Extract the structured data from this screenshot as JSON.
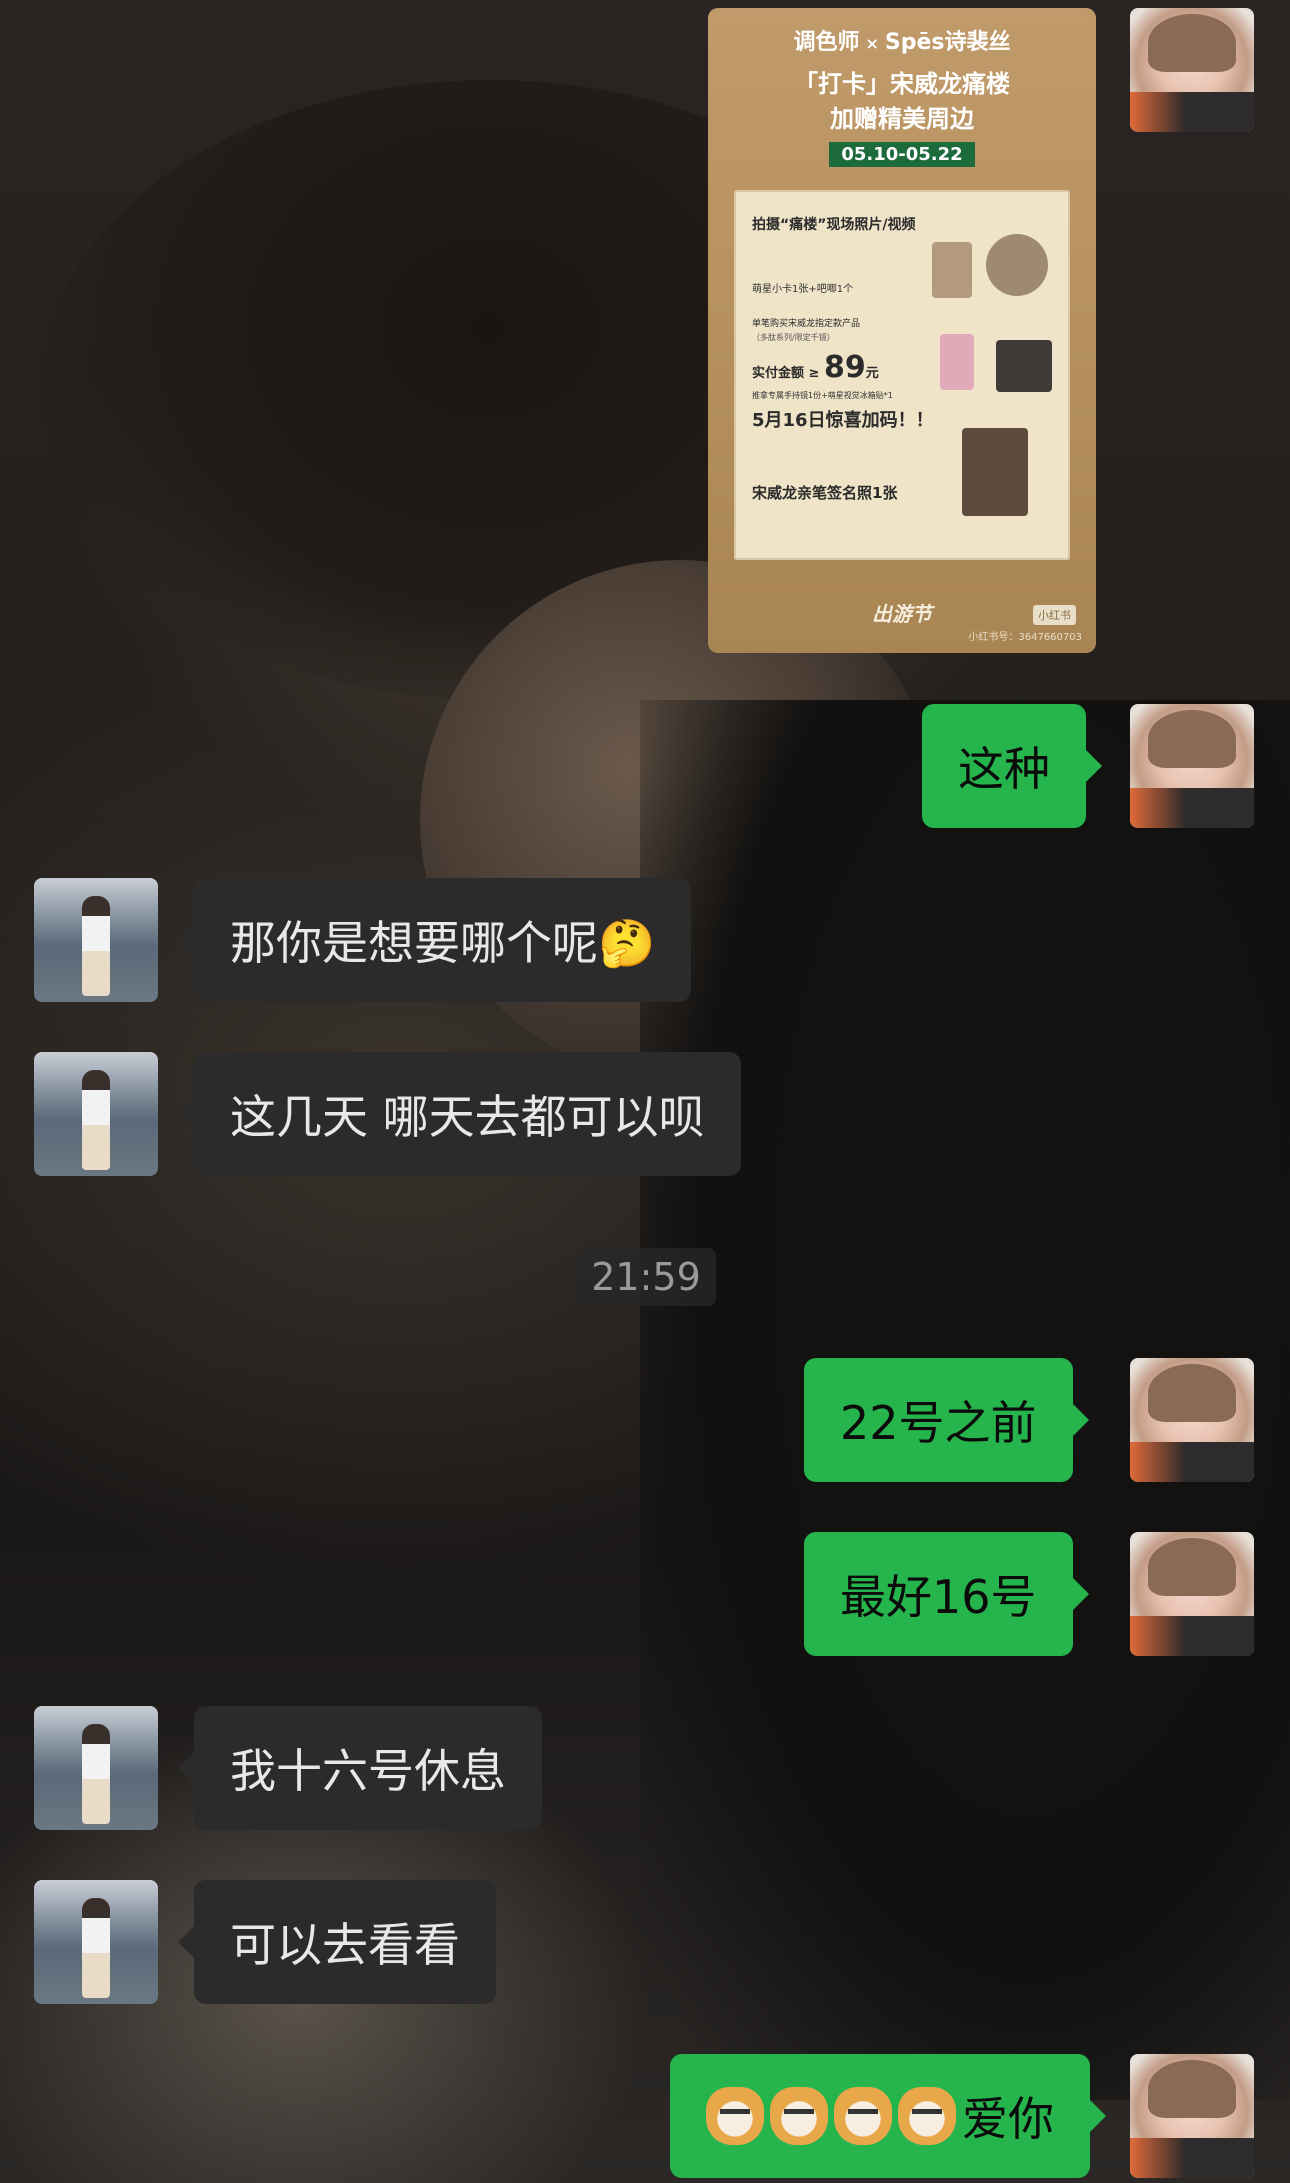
{
  "poster": {
    "brand_left": "调色师",
    "brand_x": "×",
    "brand_right": "Spēs诗裴丝",
    "title": "「打卡」宋威龙痛楼",
    "subtitle": "加赠精美周边",
    "date_range": "05.10-05.22",
    "section1": "拍摄“痛楼”现场照片/视频",
    "section1_gift": "萌星小卡1张+吧唧1个",
    "section2_line1": "单笔购买宋威龙指定款产品",
    "section2_line2": "（多肽系列/限定千镜）",
    "section2_price_label": "实付金额 ≥",
    "section2_price": "89",
    "section2_price_unit": "元",
    "section2_gift": "推拿专属手持镜1份+萌星视觉冰箱贴*1",
    "section3": "5月16日惊喜加码！！",
    "section3_gift": "宋威龙亲笔签名照1张",
    "footer": "出游节",
    "tag": "小红书",
    "tag_id": "小红书号：3647660703"
  },
  "messages": [
    {
      "side": "sent",
      "text": "这种"
    },
    {
      "side": "recv",
      "text": "那你是想要哪个呢🤔"
    },
    {
      "side": "recv",
      "text": "这几天 哪天去都可以呗"
    },
    {
      "side": "sent",
      "text": "22号之前"
    },
    {
      "side": "sent",
      "text": "最好16号"
    },
    {
      "side": "recv",
      "text": "我十六号休息"
    },
    {
      "side": "recv",
      "text": "可以去看看"
    },
    {
      "side": "sent",
      "text": "爱你",
      "emoji": [
        "doge",
        "doge",
        "doge",
        "doge"
      ]
    }
  ],
  "timestamp": "21:59"
}
